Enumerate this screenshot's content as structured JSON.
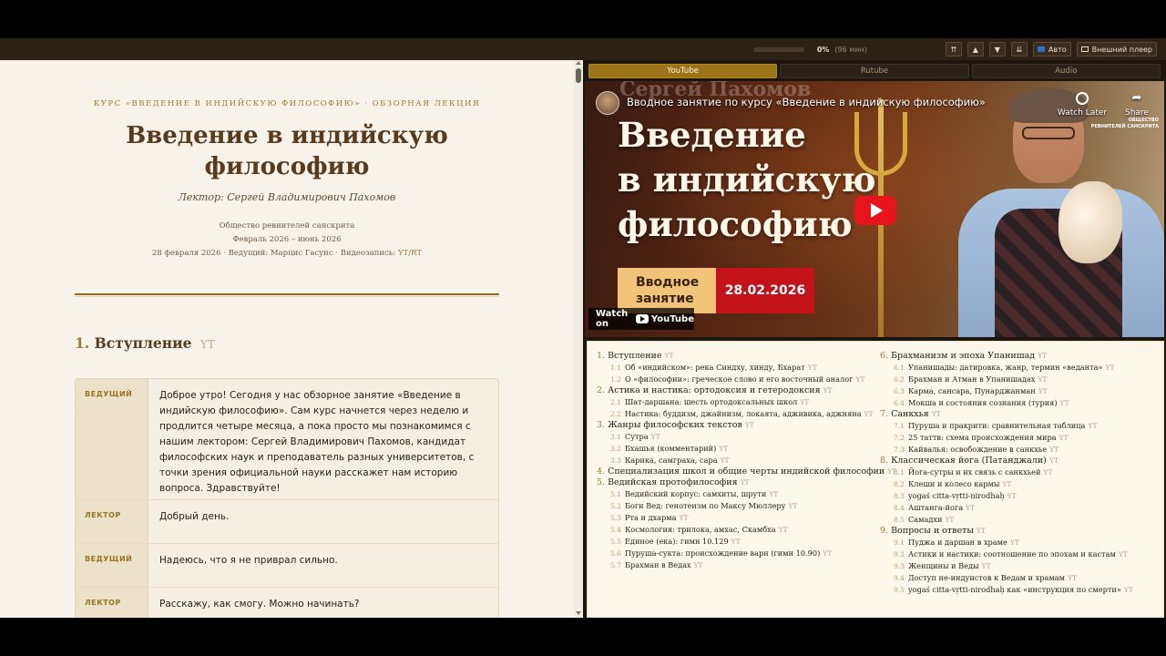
{
  "toolbar": {
    "progress": 0.0,
    "percent": "0%",
    "minutes": "(96 мин)",
    "btn_top": "⇈",
    "btn_up": "▲",
    "btn_down": "▼",
    "btn_bottom": "⇊",
    "auto_label": "Авто",
    "external_label": "Внешний плеер"
  },
  "document": {
    "course_line": "КУРС «ВВЕДЕНИЕ В ИНДИЙСКУЮ ФИЛОСОФИЮ» · ОБЗОРНАЯ ЛЕКЦИЯ",
    "title_line1": "Введение в индийскую",
    "title_line2": "философию",
    "lecturer": "Лектор: Сергей Владимирович Пахомов",
    "society": "Общество ревнителей санскрита",
    "period": "Февраль 2026 – июнь 2026",
    "session_info": "28 февраля 2026 · Ведущий: Марцис Гасунс · Видеозапись:",
    "session_link": "YT/RT",
    "section1_num": "1.",
    "section1_title": "Вступление",
    "section1_yt": "YT"
  },
  "dialog": [
    {
      "speaker": "ВЕДУЩИЙ",
      "text": "Доброе утро! Сегодня у нас обзорное занятие «Введение в индийскую философию». Сам курс начнется через неделю и продлится четыре месяца, а пока просто мы познакомимся с нашим лектором: Сергей Владимирович Пахомов, кандидат философских наук и преподаватель разных университетов, с точки зрения официальной науки расскажет нам историю вопроса. Здравствуйте!"
    },
    {
      "speaker": "ЛЕКТОР",
      "text": "Добрый день."
    },
    {
      "speaker": "ВЕДУЩИЙ",
      "text": "Надеюсь, что я не приврал сильно."
    },
    {
      "speaker": "ЛЕКТОР",
      "text": "Расскажу, как смогу. Можно начинать?"
    }
  ],
  "player_tabs": [
    "YouTube",
    "Rutube",
    "Audio"
  ],
  "video": {
    "ghost_name": "Сергей Пахомов",
    "title": "Вводное занятие по курсу «Введение в индийскую философию»",
    "big_line1": "Введение",
    "big_line2": "в индийскую",
    "big_line3": "философию",
    "badge_line1": "Вводное",
    "badge_line2": "занятие",
    "badge_date": "28.02.2026",
    "watch_on": "Watch on",
    "yt_brand": "YouTube",
    "watch_later": "Watch Later",
    "share": "Share",
    "org_line1": "ОБЩЕСТВО",
    "org_line2": "РЕВНИТЕЛЕЙ САНСКРИТА"
  },
  "toc": {
    "yt": "YT",
    "left": [
      {
        "n": "1.",
        "t": "Вступление",
        "subs": [
          {
            "n": "1.1",
            "t": "Об «индийском»: река Синдху, хинду, Бхарат"
          },
          {
            "n": "1.2",
            "t": "О «философии»: греческое слово и его восточный аналог"
          }
        ]
      },
      {
        "n": "2.",
        "t": "Астика и настика: ортодоксия и гетеродоксия",
        "subs": [
          {
            "n": "2.1",
            "t": "Шат-даршана: шесть ортодоксальных школ"
          },
          {
            "n": "2.2",
            "t": "Настика: буддизм, джайнизм, локаята, адживика, аджняна"
          }
        ]
      },
      {
        "n": "3.",
        "t": "Жанры философских текстов",
        "subs": [
          {
            "n": "3.1",
            "t": "Сутра"
          },
          {
            "n": "3.2",
            "t": "Бхашья (комментарий)"
          },
          {
            "n": "3.3",
            "t": "Карика, самграха, сара"
          }
        ]
      },
      {
        "n": "4.",
        "t": "Специализация школ и общие черты индийской философии",
        "subs": []
      },
      {
        "n": "5.",
        "t": "Ведийская протофилософия",
        "subs": [
          {
            "n": "5.1",
            "t": "Ведийский корпус: самхиты, шрути"
          },
          {
            "n": "5.2",
            "t": "Боги Вед: генотеизм по Максу Мюллеру"
          },
          {
            "n": "5.3",
            "t": "Рта и дхарма"
          },
          {
            "n": "5.4",
            "t": "Космология: трилока, амхас, Скамбха"
          },
          {
            "n": "5.5",
            "t": "Единое (ека): гимн 10.129"
          },
          {
            "n": "5.6",
            "t": "Пуруша-сукта: происхождение варн (гимн 10.90)"
          },
          {
            "n": "5.7",
            "t": "Брахман в Ведах"
          }
        ]
      }
    ],
    "right": [
      {
        "n": "6.",
        "t": "Брахманизм и эпоха Упанишад",
        "subs": [
          {
            "n": "6.1",
            "t": "Упанишады: датировка, жанр, термин «веданта»"
          },
          {
            "n": "6.2",
            "t": "Брахман и Атман в Упанишадах"
          },
          {
            "n": "6.3",
            "t": "Карма, сансара, Пунарджанман"
          },
          {
            "n": "6.4",
            "t": "Мокша и состояния сознания (турия)"
          }
        ]
      },
      {
        "n": "7.",
        "t": "Санкхья",
        "subs": [
          {
            "n": "7.1",
            "t": "Пуруша и пракрити: сравнительная таблица"
          },
          {
            "n": "7.2",
            "t": "25 таттв: схема происхождения мира"
          },
          {
            "n": "7.3",
            "t": "Кайвалья: освобождение в санкхье"
          }
        ]
      },
      {
        "n": "8.",
        "t": "Классическая йога (Патанджали)",
        "subs": [
          {
            "n": "8.1",
            "t": "Йога-сутры и их связь с санкхьей"
          },
          {
            "n": "8.2",
            "t": "Клеши и колесо кармы"
          },
          {
            "n": "8.3",
            "t": "yogaś citta-vṛtti-nirodhaḥ"
          },
          {
            "n": "8.4",
            "t": "Аштанга-йога"
          },
          {
            "n": "8.5",
            "t": "Самадхи"
          }
        ]
      },
      {
        "n": "9.",
        "t": "Вопросы и ответы",
        "subs": [
          {
            "n": "9.1",
            "t": "Пуджа и даршан в храме"
          },
          {
            "n": "9.2",
            "t": "Астики и настики: соотношение по эпохам и кастам"
          },
          {
            "n": "9.3",
            "t": "Женщины и Веды"
          },
          {
            "n": "9.4",
            "t": "Доступ не-индуистов к Ведам и храмам"
          },
          {
            "n": "9.5",
            "t": "yogaś citta-vṛtti-nirodhaḥ как «инструкция по смерти»"
          }
        ]
      }
    ]
  }
}
